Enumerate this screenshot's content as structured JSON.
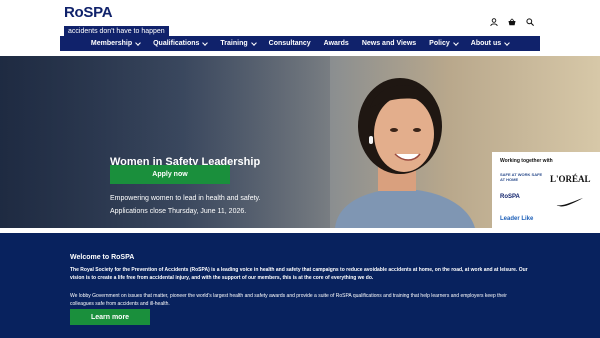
{
  "header": {
    "logo_wordmark": "RoSPA",
    "logo_tagline": "accidents don't have to happen",
    "icons": [
      "account-icon",
      "basket-icon",
      "search-icon"
    ]
  },
  "nav": {
    "items": [
      {
        "label": "Membership",
        "dropdown": true
      },
      {
        "label": "Qualifications",
        "dropdown": true
      },
      {
        "label": "Training",
        "dropdown": true
      },
      {
        "label": "Consultancy",
        "dropdown": false
      },
      {
        "label": "Awards",
        "dropdown": false
      },
      {
        "label": "News and Views",
        "dropdown": false
      },
      {
        "label": "Policy",
        "dropdown": true
      },
      {
        "label": "About us",
        "dropdown": true
      }
    ]
  },
  "hero": {
    "title": "Women in Safety Leadership Programme",
    "subtitle": "Empowering women to lead in health and safety.",
    "deadline": "Applications close Thursday, June 11, 2026.",
    "cta": "Apply now"
  },
  "partners": {
    "title": "Working together with",
    "logos": [
      "SAFE AT WORK SAFE AT HOME",
      "L'ORÉAL",
      "RoSPA",
      "Nike",
      "Leader Like"
    ]
  },
  "welcome": {
    "title": "Welcome to RoSPA",
    "para1": "The Royal Society for the Prevention of Accidents (RoSPA) is a leading voice in health and safety that campaigns to reduce avoidable accidents at home, on the road, at work and at leisure. Our vision is to create a life free from accidental injury, and with the support of our members, this is at the core of everything we do.",
    "para2": "We lobby Government on issues that matter, pioneer the world's largest health and safety awards and provide a suite of RoSPA qualifications and training that help learners and employers keep their colleagues safe from accidents and ill-health.",
    "cta": "Learn more"
  },
  "colors": {
    "navy": "#10226b",
    "green": "#1a8f3c",
    "section_bg": "#08225e"
  }
}
